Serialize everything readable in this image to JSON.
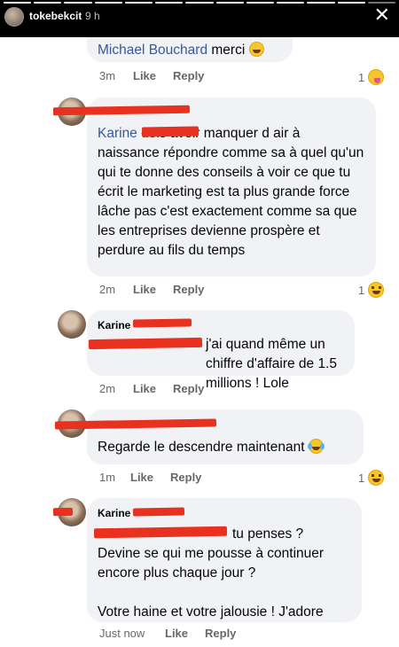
{
  "story": {
    "username": "tokebekcit",
    "time": "9 h",
    "close_icon": "close-icon"
  },
  "comments": [
    {
      "author": "",
      "mention": "Michael Bouchard",
      "text": " merci",
      "time": "3m",
      "like": "Like",
      "reply": "Reply",
      "reaction_count": "1"
    },
    {
      "author": "",
      "mention": "Karine",
      "text": " dois avoir manquer d air à naissance répondre comme sa à quel qu'un qui te donne des conseils à voir ce que tu écrit le marketing est ta plus grande force lâche pas c'est exactement comme sa que les entreprises devienne prospère et perdure au fils du temps",
      "time": "2m",
      "like": "Like",
      "reply": "Reply",
      "reaction_count": "1"
    },
    {
      "author": "Karine",
      "mention": "",
      "text": "j'ai quand même un chiffre d'affaire de 1.5 millions ! Lole",
      "time": "2m",
      "like": "Like",
      "reply": "Reply"
    },
    {
      "author": "",
      "mention": "",
      "text": "Regarde le descendre maintenant",
      "time": "1m",
      "like": "Like",
      "reply": "Reply",
      "reaction_count": "1"
    },
    {
      "author": "Karine",
      "mention": "",
      "line1": "tu penses ?",
      "line2": "Devine se qui me pousse à continuer",
      "line3": "encore plus chaque jour ?",
      "line4": "Votre haine et votre jalousie ! J'adore",
      "time": "Just now",
      "like": "Like",
      "reply": "Reply"
    }
  ]
}
